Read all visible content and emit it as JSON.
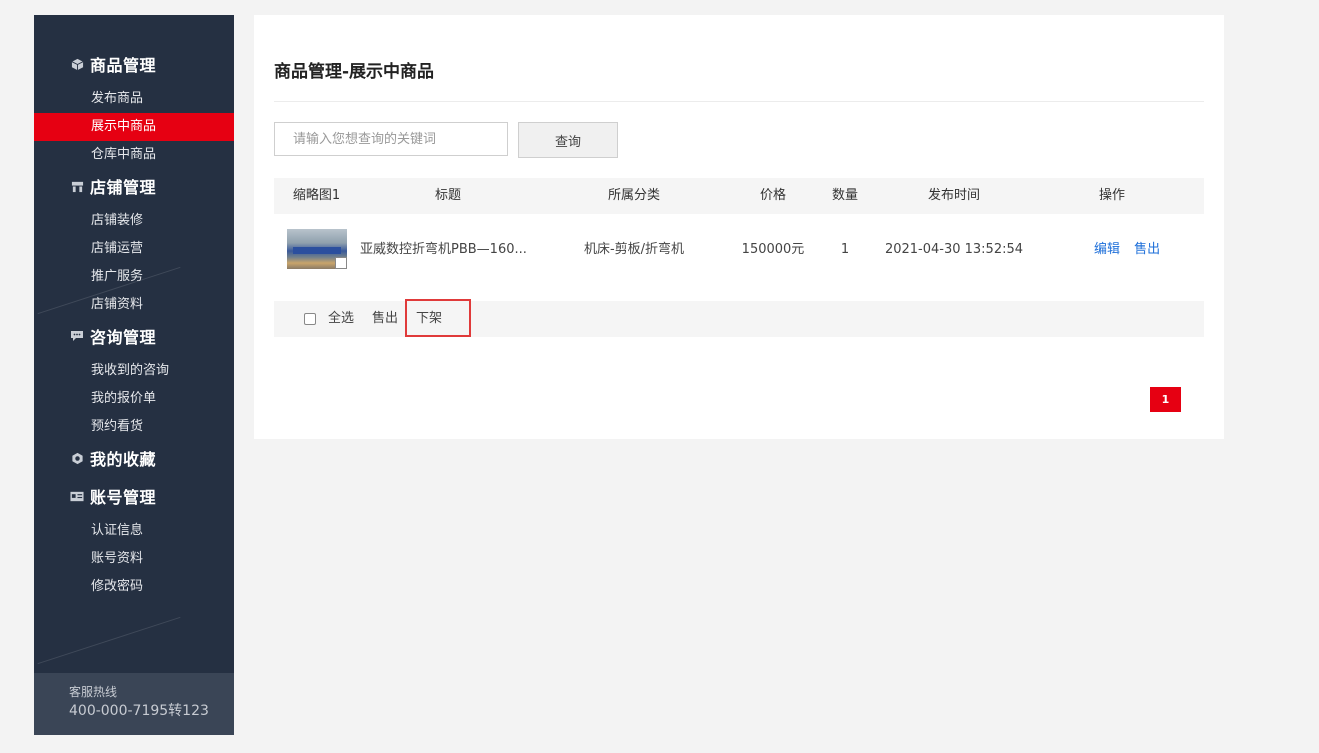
{
  "sidebar": {
    "groups": [
      {
        "title": "商品管理",
        "icon": "cube-icon",
        "items": [
          "发布商品",
          "展示中商品",
          "仓库中商品"
        ]
      },
      {
        "title": "店铺管理",
        "icon": "store-icon",
        "items": [
          "店铺装修",
          "店铺运营",
          "推广服务",
          "店铺资料"
        ]
      },
      {
        "title": "咨询管理",
        "icon": "chat-icon",
        "items": [
          "我收到的咨询",
          "我的报价单",
          "预约看货"
        ]
      },
      {
        "title": "我的收藏",
        "icon": "hexagon-icon",
        "items": []
      },
      {
        "title": "账号管理",
        "icon": "id-card-icon",
        "items": [
          "认证信息",
          "账号资料",
          "修改密码"
        ]
      }
    ],
    "active_item": "展示中商品",
    "hotline_label": "客服热线",
    "hotline_number": "400-000-7195转123"
  },
  "main": {
    "title": "商品管理-展示中商品",
    "search": {
      "placeholder": "请输入您想查询的关键词",
      "button": "查询"
    },
    "columns": [
      "缩略图1",
      "标题",
      "所属分类",
      "价格",
      "数量",
      "发布时间",
      "操作"
    ],
    "rows": [
      {
        "title": "亚威数控折弯机PBB—160...",
        "category": "机床-剪板/折弯机",
        "price": "150000元",
        "quantity": "1",
        "published": "2021-04-30 13:52:54",
        "actions": [
          "编辑",
          "售出"
        ]
      }
    ],
    "batch": {
      "select_all": "全选",
      "sold": "售出",
      "off_shelf": "下架"
    },
    "pagination": {
      "current": "1"
    }
  },
  "colors": {
    "sidebar_bg": "#253042",
    "accent": "#e60012",
    "link": "#1e6fd9"
  }
}
